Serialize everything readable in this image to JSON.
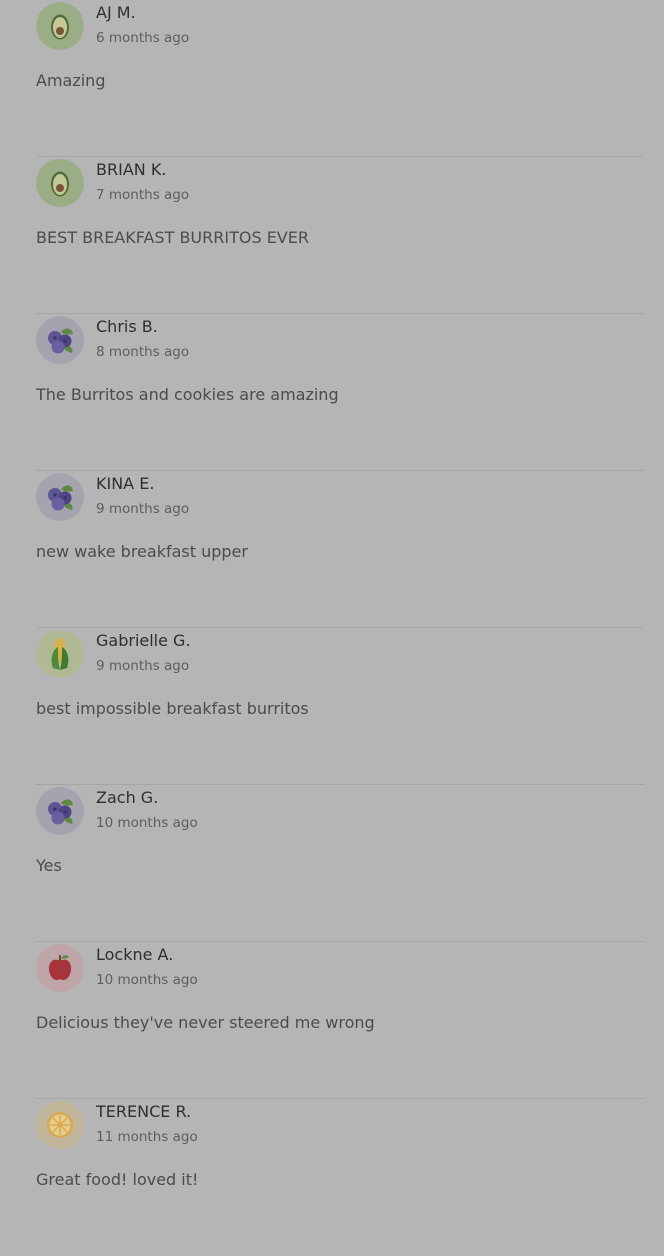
{
  "reviews": [
    {
      "name": "AJ M.",
      "time": "6 months ago",
      "text": "Amazing",
      "avatar": "avocado-icon"
    },
    {
      "name": "BRIAN K.",
      "time": "7 months ago",
      "text": "BEST BREAKFAST BURRITOS EVER",
      "avatar": "avocado-icon"
    },
    {
      "name": "Chris B.",
      "time": "8 months ago",
      "text": "The Burritos and cookies are amazing",
      "avatar": "blueberry-icon"
    },
    {
      "name": "KINA E.",
      "time": "9 months ago",
      "text": "new wake breakfast upper",
      "avatar": "blueberry-icon"
    },
    {
      "name": "Gabrielle G.",
      "time": "9 months ago",
      "text": "best impossible breakfast burritos",
      "avatar": "corn-icon"
    },
    {
      "name": "Zach G.",
      "time": "10 months ago",
      "text": "Yes",
      "avatar": "blueberry-icon"
    },
    {
      "name": "Lockne A.",
      "time": "10 months ago",
      "text": "Delicious they've never steered me wrong",
      "avatar": "apple-icon"
    },
    {
      "name": "TERENCE R.",
      "time": "11 months ago",
      "text": "Great food! loved it!",
      "avatar": "citrus-icon"
    }
  ],
  "colors": {
    "overlay_background": "#b5b5b5",
    "divider": "#a6a6a6",
    "name_text": "#2f2f2f",
    "time_text": "#5e5e5e",
    "body_text": "#4c4c4c"
  }
}
